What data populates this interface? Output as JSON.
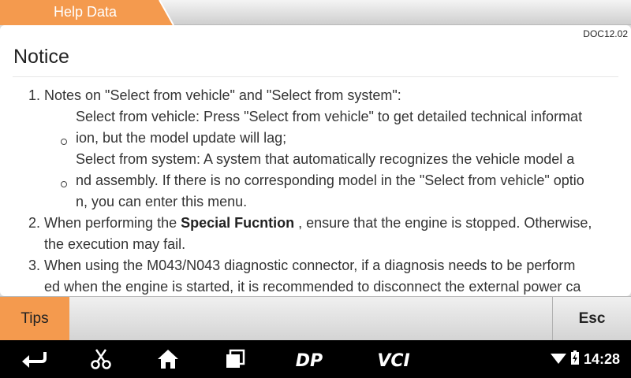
{
  "header": {
    "title": "Help Data"
  },
  "document": {
    "id": "DOC12.02",
    "title": "Notice",
    "lines": [
      "1. Notes on \"Select from vehicle\" and \"Select from system\":",
      "Select from vehicle: Press \"Select from vehicle\" to get detailed technical informat",
      "ion, but the model update will lag;",
      "Select from system: A system that automatically recognizes the vehicle model a",
      "nd assembly. If there is no corresponding model in the \"Select from vehicle\" optio",
      "n, you can enter this menu.",
      "2. When performing the ",
      "Special Fucntion",
      " , ensure that the engine is stopped. Otherwise,",
      "the execution may fail.",
      "3. When using the M043/N043 diagnostic connector, if a diagnosis needs to be perform",
      "ed when the engine is started, it is recommended to disconnect the external power ca"
    ]
  },
  "actions": {
    "tips_label": "Tips",
    "esc_label": "Esc"
  },
  "navbar": {
    "icons": [
      "back-icon",
      "scissors-icon",
      "home-icon",
      "recent-apps-icon",
      "dp-logo-icon",
      "vci-logo-icon"
    ],
    "dp_text": "DP",
    "vci_text": "VCI",
    "time": "14:28"
  },
  "colors": {
    "accent": "#f49a4e"
  }
}
